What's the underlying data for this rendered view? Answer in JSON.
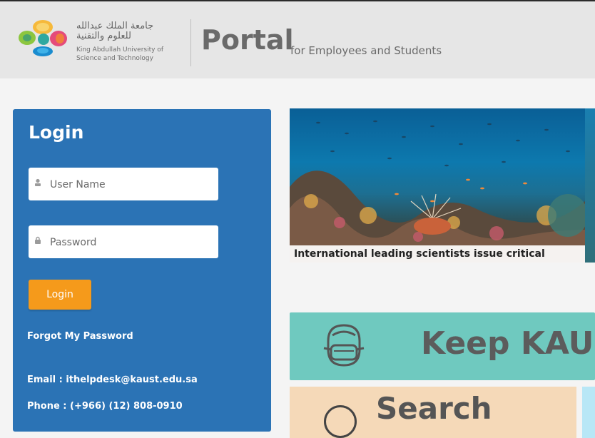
{
  "header": {
    "logo_arabic_line1": "جامعة الملك عبدالله",
    "logo_arabic_line2": "للعلوم والتقنية",
    "logo_english_line1": "King Abdullah University of",
    "logo_english_line2": "Science and Technology",
    "portal_title": "Portal",
    "portal_subtitle": "for Employees and Students"
  },
  "login": {
    "title": "Login",
    "username_placeholder": "User Name",
    "password_placeholder": "Password",
    "button_label": "Login",
    "forgot_label": "Forgot My Password",
    "email": "Email : ithelpdesk@kaust.edu.sa",
    "phone": "Phone : (+966) (12) 808-0910"
  },
  "hero": {
    "caption": "International leading scientists issue critical"
  },
  "tiles": {
    "keep_text": "Keep KAUST",
    "search_text": "Search"
  },
  "colors": {
    "login_panel": "#2b73b5",
    "login_button": "#f59a1b",
    "keep_tile": "#6fc9bf",
    "search_tile": "#f5d9b8"
  }
}
